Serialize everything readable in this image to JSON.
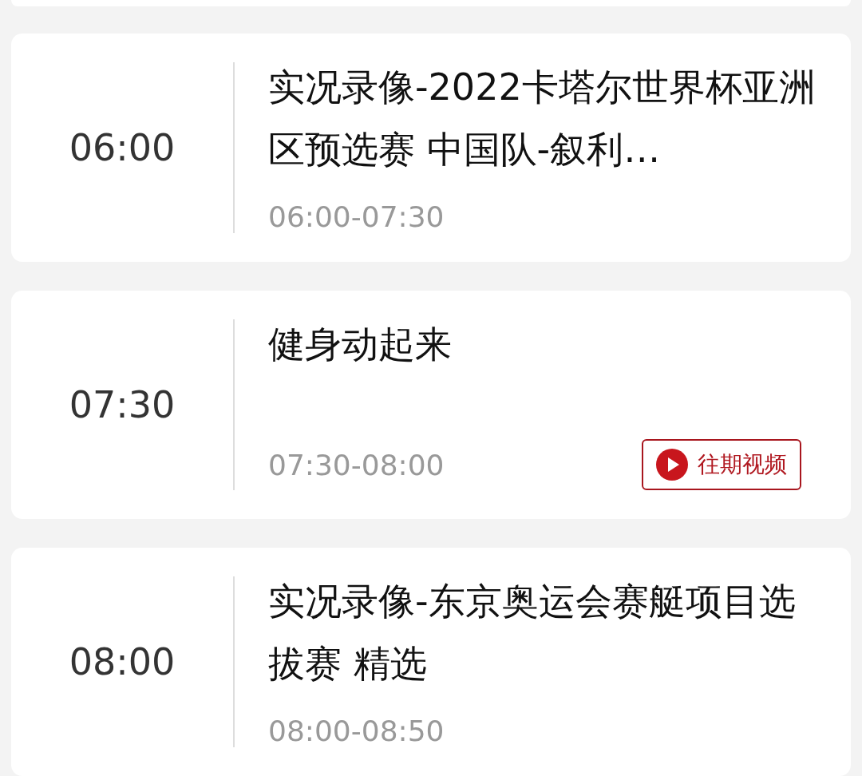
{
  "programs": [
    {
      "time": "06:00",
      "title": "实况录像-2022卡塔尔世界杯亚洲区预选赛 中国队-叙利…",
      "range": "06:00-07:30"
    },
    {
      "time": "07:30",
      "title": "健身动起来",
      "range": "07:30-08:00",
      "replay_button": "往期视频"
    },
    {
      "time": "08:00",
      "title": "实况录像-东京奥运会赛艇项目选拔赛 精选",
      "range": "08:00-08:50"
    }
  ]
}
